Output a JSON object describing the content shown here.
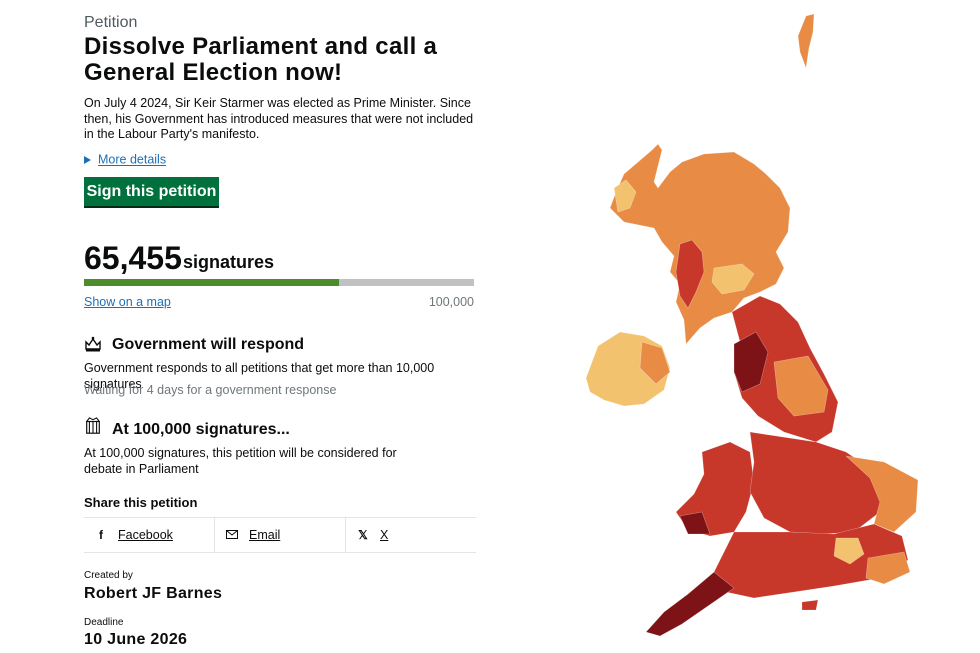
{
  "petition": {
    "kicker": "Petition",
    "title": "Dissolve Parliament and call a General Election now!",
    "summary": "On July 4 2024, Sir Keir Starmer was elected as Prime Minister. Since then, his Government has introduced measures that were not included in the Labour Party's manifesto.",
    "more_details": "More details",
    "sign_button": "Sign this petition"
  },
  "signatures": {
    "count": "65,455",
    "label": "signatures",
    "progress_fraction": 0.65455,
    "map_link": "Show on a map",
    "target": "100,000"
  },
  "response": {
    "icon": "crown-icon",
    "heading": "Government will respond",
    "text": "Government responds to all petitions that get more than 10,000 signatures",
    "status": "Waiting for 4 days for a government response"
  },
  "debate": {
    "icon": "parliament-icon",
    "heading": "At 100,000 signatures...",
    "text": "At 100,000 signatures, this petition will be considered for debate in Parliament"
  },
  "share": {
    "title": "Share this petition",
    "items": [
      {
        "icon": "facebook-icon",
        "label": "Facebook"
      },
      {
        "icon": "email-icon",
        "label": "Email"
      },
      {
        "icon": "x-icon",
        "label": "X"
      }
    ]
  },
  "creator": {
    "label": "Created by",
    "name": "Robert JF Barnes"
  },
  "deadline": {
    "label": "Deadline",
    "date": "10 June 2026"
  },
  "colors": {
    "sign_button": "#00703c",
    "progress_fill": "#4c8c2b",
    "link": "#1d70b8",
    "map_light": "#f3c26f",
    "map_mid": "#e88c45",
    "map_dark": "#c7372a",
    "map_darkest": "#7d1316"
  }
}
